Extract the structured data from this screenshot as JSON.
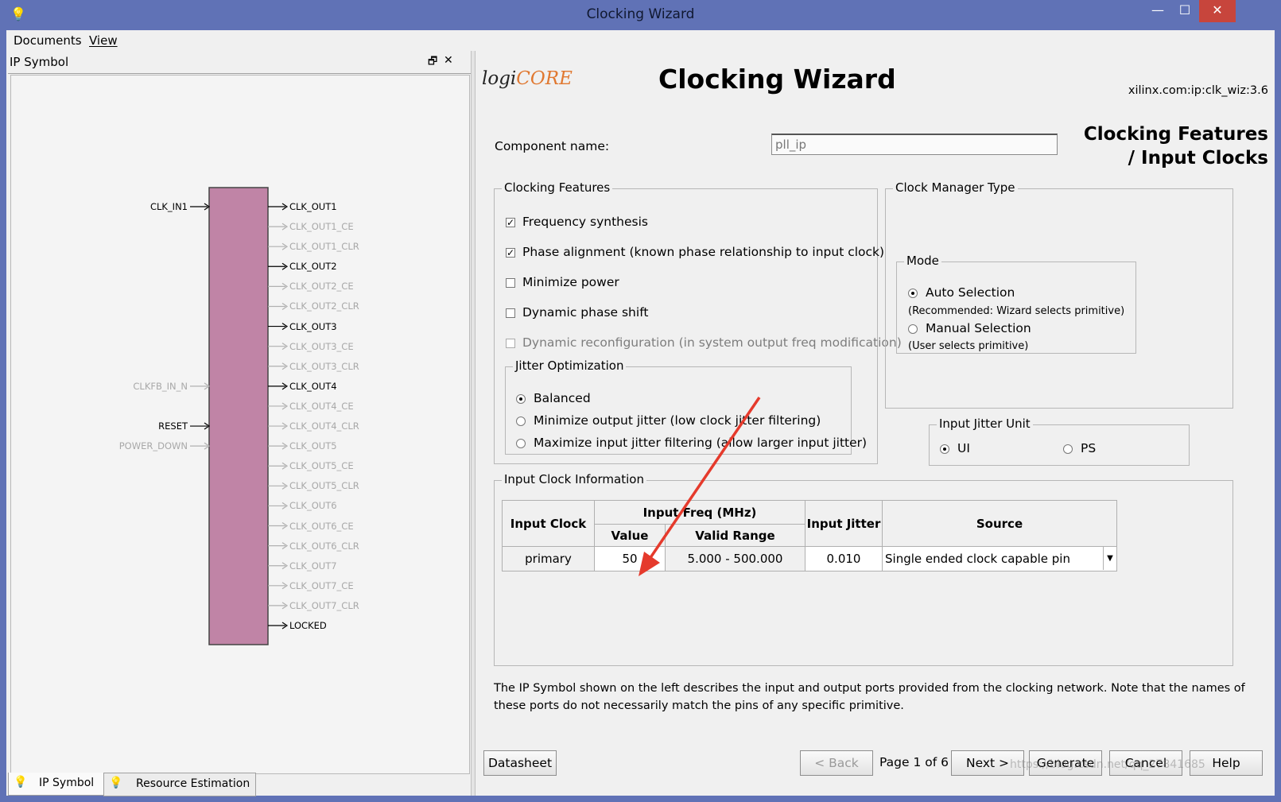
{
  "window": {
    "title": "Clocking Wizard",
    "minimize": "—",
    "maximize": "☐",
    "close": "✕"
  },
  "menu": {
    "items": [
      "Documents",
      "View"
    ]
  },
  "left_panel": {
    "title": "IP Symbol",
    "restore": "🗗",
    "close": "✕",
    "inputs": [
      {
        "label": "CLK_IN1",
        "enabled": true
      },
      {
        "label": "CLKFB_IN_N",
        "enabled": false
      },
      {
        "label": "RESET",
        "enabled": true
      },
      {
        "label": "POWER_DOWN",
        "enabled": false
      }
    ],
    "outputs": [
      {
        "label": "CLK_OUT1",
        "enabled": true
      },
      {
        "label": "CLK_OUT1_CE",
        "enabled": false
      },
      {
        "label": "CLK_OUT1_CLR",
        "enabled": false
      },
      {
        "label": "CLK_OUT2",
        "enabled": true
      },
      {
        "label": "CLK_OUT2_CE",
        "enabled": false
      },
      {
        "label": "CLK_OUT2_CLR",
        "enabled": false
      },
      {
        "label": "CLK_OUT3",
        "enabled": true
      },
      {
        "label": "CLK_OUT3_CE",
        "enabled": false
      },
      {
        "label": "CLK_OUT3_CLR",
        "enabled": false
      },
      {
        "label": "CLK_OUT4",
        "enabled": true
      },
      {
        "label": "CLK_OUT4_CE",
        "enabled": false
      },
      {
        "label": "CLK_OUT4_CLR",
        "enabled": false
      },
      {
        "label": "CLK_OUT5",
        "enabled": false
      },
      {
        "label": "CLK_OUT5_CE",
        "enabled": false
      },
      {
        "label": "CLK_OUT5_CLR",
        "enabled": false
      },
      {
        "label": "CLK_OUT6",
        "enabled": false
      },
      {
        "label": "CLK_OUT6_CE",
        "enabled": false
      },
      {
        "label": "CLK_OUT6_CLR",
        "enabled": false
      },
      {
        "label": "CLK_OUT7",
        "enabled": false
      },
      {
        "label": "CLK_OUT7_CE",
        "enabled": false
      },
      {
        "label": "CLK_OUT7_CLR",
        "enabled": false
      },
      {
        "label": "LOCKED",
        "enabled": true
      }
    ],
    "tabs": [
      {
        "label": "IP Symbol",
        "selected": true
      },
      {
        "label": "Resource Estimation",
        "selected": false
      }
    ],
    "block_color": "#c084a6"
  },
  "header": {
    "logo_logi": "logi",
    "logo_core": "CORE",
    "title": "Clocking Wizard",
    "ip_version": "xilinx.com:ip:clk_wiz:3.6",
    "page_title_line1": "Clocking Features",
    "page_title_line2": "/ Input Clocks"
  },
  "component": {
    "label": "Component name:",
    "value": "pll_ip"
  },
  "clocking_features": {
    "title": "Clocking Features",
    "options": [
      {
        "label": "Frequency synthesis",
        "checked": true,
        "enabled": true
      },
      {
        "label": "Phase alignment (known phase relationship to input clock)",
        "checked": true,
        "enabled": true
      },
      {
        "label": "Minimize power",
        "checked": false,
        "enabled": true
      },
      {
        "label": "Dynamic phase shift",
        "checked": false,
        "enabled": true
      },
      {
        "label": "Dynamic reconfiguration (in system output freq modification)",
        "checked": false,
        "enabled": false
      }
    ],
    "check_glyph": "✓"
  },
  "jitter_optimization": {
    "title": "Jitter Optimization",
    "options": [
      {
        "label": "Balanced",
        "selected": true
      },
      {
        "label": "Minimize output jitter (low clock jitter filtering)",
        "selected": false
      },
      {
        "label": "Maximize input jitter filtering (allow larger input jitter)",
        "selected": false
      }
    ]
  },
  "clock_manager": {
    "title": "Clock Manager Type",
    "mode_title": "Mode",
    "auto_label": "Auto Selection",
    "auto_hint": "(Recommended:  Wizard selects primitive)",
    "manual_label": "Manual Selection",
    "manual_hint": "(User selects primitive)",
    "auto_selected": true
  },
  "input_jitter_unit": {
    "title": "Input Jitter Unit",
    "ui_label": "UI",
    "ps_label": "PS",
    "ui_selected": true
  },
  "input_clock_info": {
    "title": "Input Clock Information",
    "headers": {
      "input_clock": "Input Clock",
      "input_freq": "Input Freq (MHz)",
      "value": "Value",
      "valid_range": "Valid Range",
      "input_jitter": "Input Jitter",
      "source": "Source"
    },
    "row": {
      "input_clock": "primary",
      "value": "50",
      "valid_range": "5.000 - 500.000",
      "input_jitter": "0.010",
      "source": "Single ended clock capable pin"
    }
  },
  "note": "The IP Symbol shown on the left describes the input and output ports provided from the clocking network.  Note that the names of these ports do not necessarily match the pins of any specific primitive.",
  "footer": {
    "datasheet": "Datasheet",
    "back": "< Back",
    "page_info": "Page 1 of 6",
    "next": "Next >",
    "generate": "Generate",
    "cancel": "Cancel",
    "help": "Help",
    "watermark": "https://blog.csdn.net/qq_27841685"
  },
  "colors": {
    "window_frame": "#6072b6",
    "close_button": "#c7453c",
    "annotation_arrow": "#e53a2c"
  }
}
